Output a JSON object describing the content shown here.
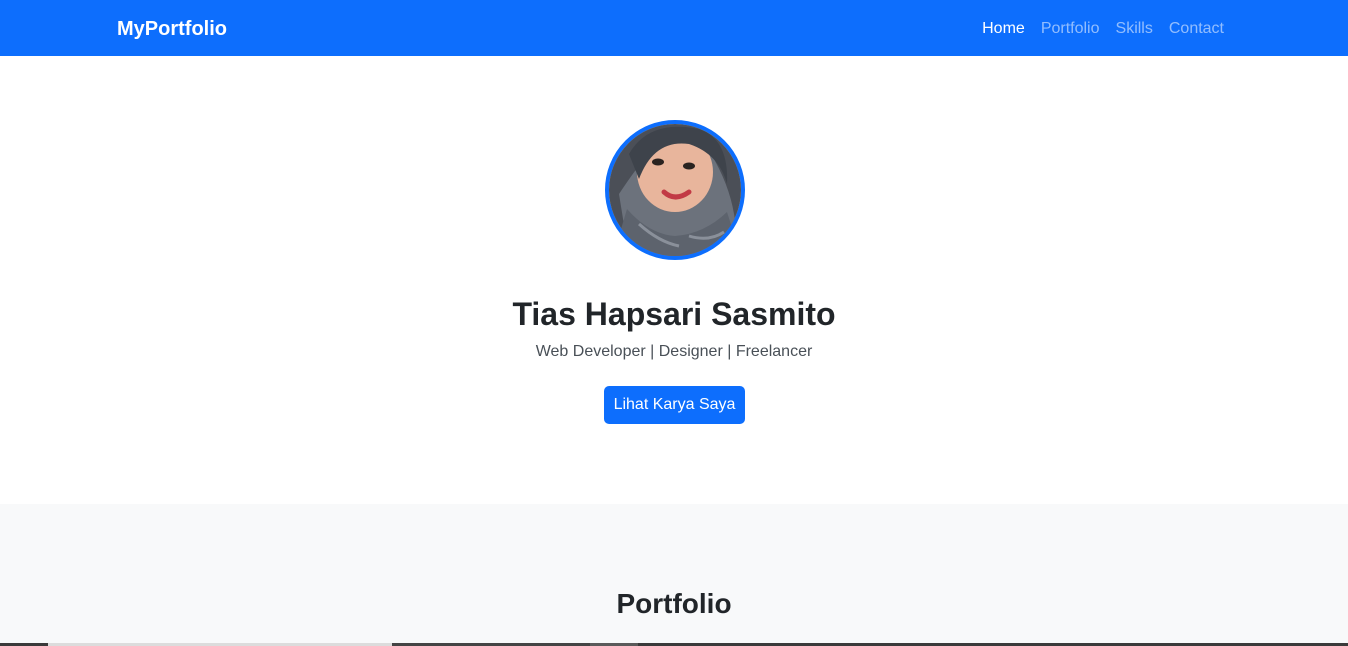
{
  "navbar": {
    "brand": "MyPortfolio",
    "links": [
      {
        "label": "Home",
        "active": true
      },
      {
        "label": "Portfolio",
        "active": false
      },
      {
        "label": "Skills",
        "active": false
      },
      {
        "label": "Contact",
        "active": false
      }
    ]
  },
  "hero": {
    "name": "Tias Hapsari Sasmito",
    "tagline": "Web Developer | Designer | Freelancer",
    "cta_label": "Lihat Karya Saya"
  },
  "portfolio": {
    "title": "Portfolio"
  },
  "colors": {
    "primary": "#0d6efd",
    "section_bg": "#f8f9fa",
    "text_dark": "#212529",
    "text_muted": "#495057"
  }
}
